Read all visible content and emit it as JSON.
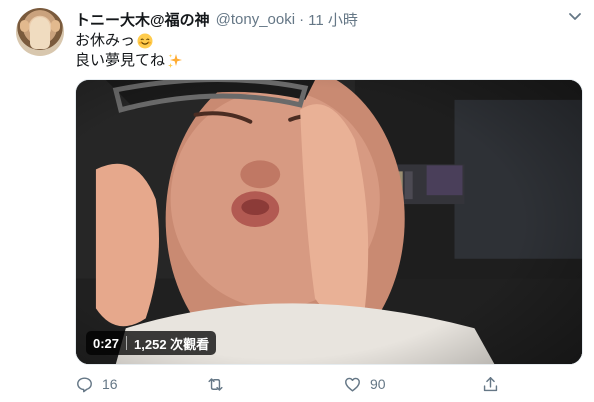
{
  "tweet": {
    "author_name": "トニー大木@福の神",
    "author_handle": "@tony_ooki",
    "separator": "·",
    "time": "11 小時",
    "text_lines": [
      "お休みっ",
      "良い夢見てね"
    ],
    "avatar_icon": "avatar-photo",
    "menu_icon": "chevron-down-icon"
  },
  "video": {
    "duration": "0:27",
    "views": "1,252 次觀看"
  },
  "actions": {
    "reply_count": "16",
    "retweet_count": "",
    "like_count": "90",
    "icons": [
      "reply-icon",
      "retweet-icon",
      "like-icon",
      "share-icon"
    ]
  },
  "colors": {
    "text": "#14171a",
    "secondary": "#657786",
    "border": "#e6ecf0"
  }
}
